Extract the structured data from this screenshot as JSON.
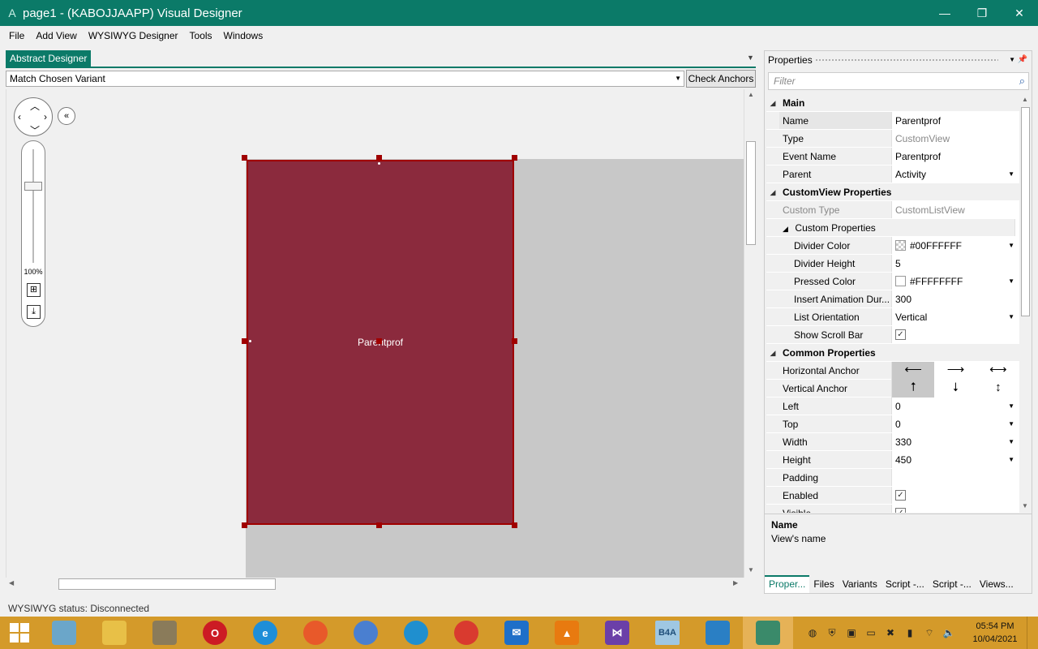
{
  "window": {
    "app_icon": "A",
    "title": "page1 - (KABOJJAAPP) Visual Designer",
    "minimize": "—",
    "restore": "❐",
    "close": "✕",
    "accent": "#0b7a68"
  },
  "menu": [
    "File",
    "Add View",
    "WYSIWYG Designer",
    "Tools",
    "Windows"
  ],
  "designer": {
    "tab_label": "Abstract Designer",
    "variant_value": "Match Chosen Variant",
    "check_anchors_label": "Check Anchors",
    "zoom_label": "100%",
    "view_label": "Parentprof",
    "view_color": "#8b2a3d",
    "zoom_level_percent": 100
  },
  "properties": {
    "title": "Properties",
    "filter_placeholder": "Filter",
    "rows": [
      {
        "kind": "cat",
        "name": "Main"
      },
      {
        "kind": "prop",
        "name": "Name",
        "value": "Parentprof",
        "selected": true
      },
      {
        "kind": "prop",
        "name": "Type",
        "value": "CustomView",
        "readonly": true
      },
      {
        "kind": "prop",
        "name": "Event Name",
        "value": "Parentprof"
      },
      {
        "kind": "prop",
        "name": "Parent",
        "value": "Activity",
        "dropdown": true
      },
      {
        "kind": "cat",
        "name": "CustomView Properties"
      },
      {
        "kind": "prop",
        "name": "Custom Type",
        "value": "CustomListView",
        "readonly": true,
        "namegray": true
      },
      {
        "kind": "subcat",
        "name": "Custom Properties"
      },
      {
        "kind": "sub",
        "name": "Divider Color",
        "value": "#00FFFFFF",
        "swatch": "checker",
        "dropdown": true
      },
      {
        "kind": "sub",
        "name": "Divider Height",
        "value": "5"
      },
      {
        "kind": "sub",
        "name": "Pressed Color",
        "value": "#FFFFFFFF",
        "swatch": "white",
        "dropdown": true
      },
      {
        "kind": "sub",
        "name": "Insert Animation Dur...",
        "value": "300"
      },
      {
        "kind": "sub",
        "name": "List Orientation",
        "value": "Vertical",
        "dropdown": true
      },
      {
        "kind": "sub",
        "name": "Show Scroll Bar",
        "checkbox": true
      },
      {
        "kind": "cat",
        "name": "Common Properties"
      },
      {
        "kind": "anchor",
        "name": "Horizontal Anchor",
        "icons": [
          "⟵",
          "⟶",
          "⟷"
        ],
        "active_index": 0
      },
      {
        "kind": "anchor",
        "name": "Vertical Anchor",
        "icons": [
          "⭡",
          "⭣",
          "↕"
        ],
        "active_index": 0
      },
      {
        "kind": "prop",
        "name": "Left",
        "value": "0",
        "dropdown": true
      },
      {
        "kind": "prop",
        "name": "Top",
        "value": "0",
        "dropdown": true
      },
      {
        "kind": "prop",
        "name": "Width",
        "value": "330",
        "dropdown": true
      },
      {
        "kind": "prop",
        "name": "Height",
        "value": "450",
        "dropdown": true
      },
      {
        "kind": "prop",
        "name": "Padding",
        "value": ""
      },
      {
        "kind": "prop",
        "name": "Enabled",
        "checkbox": true
      },
      {
        "kind": "prop",
        "name": "Visible",
        "checkbox": true
      }
    ],
    "description_title": "Name",
    "description_text": "View's name",
    "tabs": [
      "Proper...",
      "Files",
      "Variants",
      "Script -...",
      "Script -...",
      "Views..."
    ]
  },
  "status": "WYSIWYG status: Disconnected",
  "taskbar": {
    "apps": [
      {
        "name": "notepad-icon",
        "label": "",
        "color": "#6ba6c9"
      },
      {
        "name": "file-explorer-icon",
        "label": "",
        "color": "#e8c047"
      },
      {
        "name": "tools-icon",
        "label": "",
        "color": "#8a7b5a"
      },
      {
        "name": "opera-icon",
        "label": "O",
        "color": "#cc1b24"
      },
      {
        "name": "internet-explorer-icon",
        "label": "e",
        "color": "#1e8ed8"
      },
      {
        "name": "firefox-icon",
        "label": "",
        "color": "#e8592a"
      },
      {
        "name": "chromium-icon",
        "label": "",
        "color": "#4a7fd0"
      },
      {
        "name": "edge-icon",
        "label": "",
        "color": "#1f8fcf"
      },
      {
        "name": "chrome-icon",
        "label": "",
        "color": "#d93a2f"
      },
      {
        "name": "mail-icon",
        "label": "✉",
        "color": "#1e6fc8"
      },
      {
        "name": "vlc-icon",
        "label": "▲",
        "color": "#e87a10"
      },
      {
        "name": "visual-studio-icon",
        "label": "⋈",
        "color": "#6b3fa8"
      },
      {
        "name": "b4a-icon",
        "label": "B4A",
        "color": "#9fc7e2"
      },
      {
        "name": "droplet-icon",
        "label": "",
        "color": "#2a7fc4"
      },
      {
        "name": "app-icon",
        "label": "",
        "color": "#3a8a6a"
      }
    ],
    "time": "05:54 PM",
    "date": "10/04/2021"
  }
}
